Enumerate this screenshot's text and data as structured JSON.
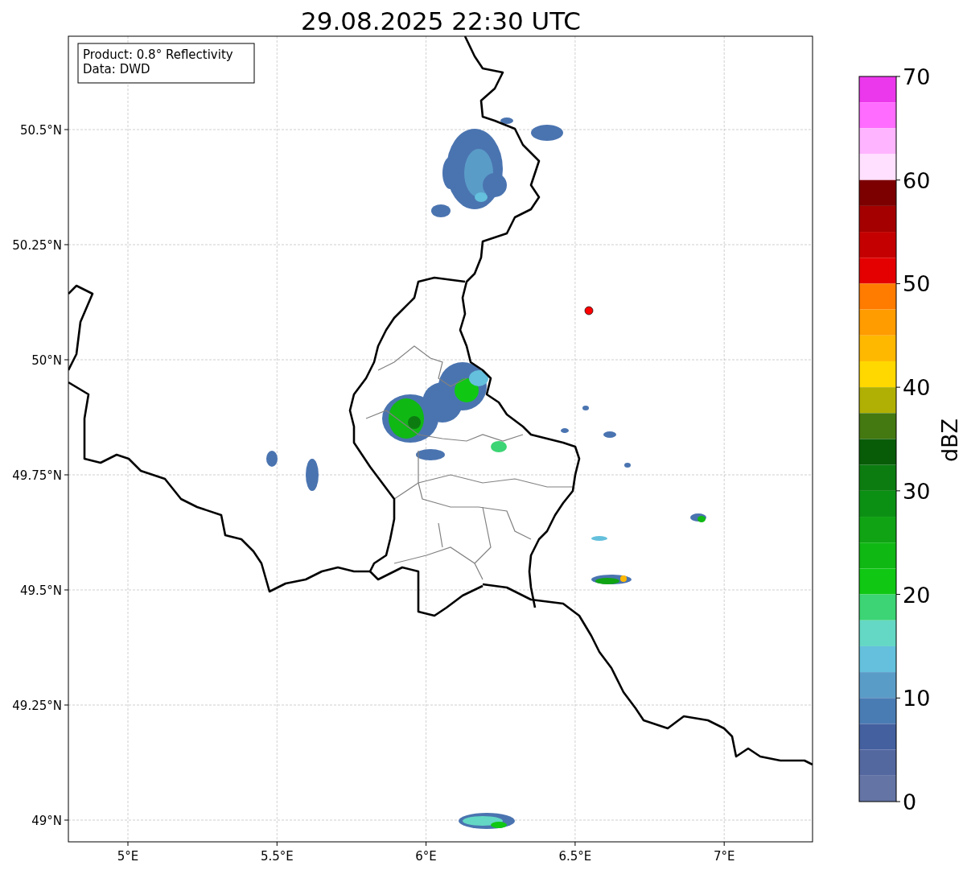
{
  "title": "29.08.2025 22:30 UTC",
  "info_box": [
    "Product: 0.8° Reflectivity",
    "Data: DWD"
  ],
  "x_ticks": [
    "5°E",
    "5.5°E",
    "6°E",
    "6.5°E",
    "7°E"
  ],
  "y_ticks": [
    "50.5°N",
    "50.25°N",
    "50°N",
    "49.75°N",
    "49.5°N",
    "49.25°N",
    "49°N"
  ],
  "colorbar": {
    "label": "dBZ",
    "ticks": [
      "70",
      "60",
      "50",
      "40",
      "30",
      "20",
      "10",
      "0"
    ],
    "bins": [
      {
        "color": "#ec38ec"
      },
      {
        "color": "#ff6cff"
      },
      {
        "color": "#ffb4ff"
      },
      {
        "color": "#ffe0ff"
      },
      {
        "color": "#7c0000"
      },
      {
        "color": "#a40000"
      },
      {
        "color": "#c40000"
      },
      {
        "color": "#e40000"
      },
      {
        "color": "#ff7c00"
      },
      {
        "color": "#ff9c00"
      },
      {
        "color": "#ffb800"
      },
      {
        "color": "#ffd800"
      },
      {
        "color": "#b0b004"
      },
      {
        "color": "#447810"
      },
      {
        "color": "#085c08"
      },
      {
        "color": "#0c7c10"
      },
      {
        "color": "#0c9014"
      },
      {
        "color": "#10a414"
      },
      {
        "color": "#10b814"
      },
      {
        "color": "#10c814"
      },
      {
        "color": "#3cd474"
      },
      {
        "color": "#64d8c4"
      },
      {
        "color": "#64c0dc"
      },
      {
        "color": "#5a9cc8"
      },
      {
        "color": "#4a7cb4"
      },
      {
        "color": "#44609f"
      },
      {
        "color": "#5468a0"
      },
      {
        "color": "#6474a4"
      }
    ]
  }
}
